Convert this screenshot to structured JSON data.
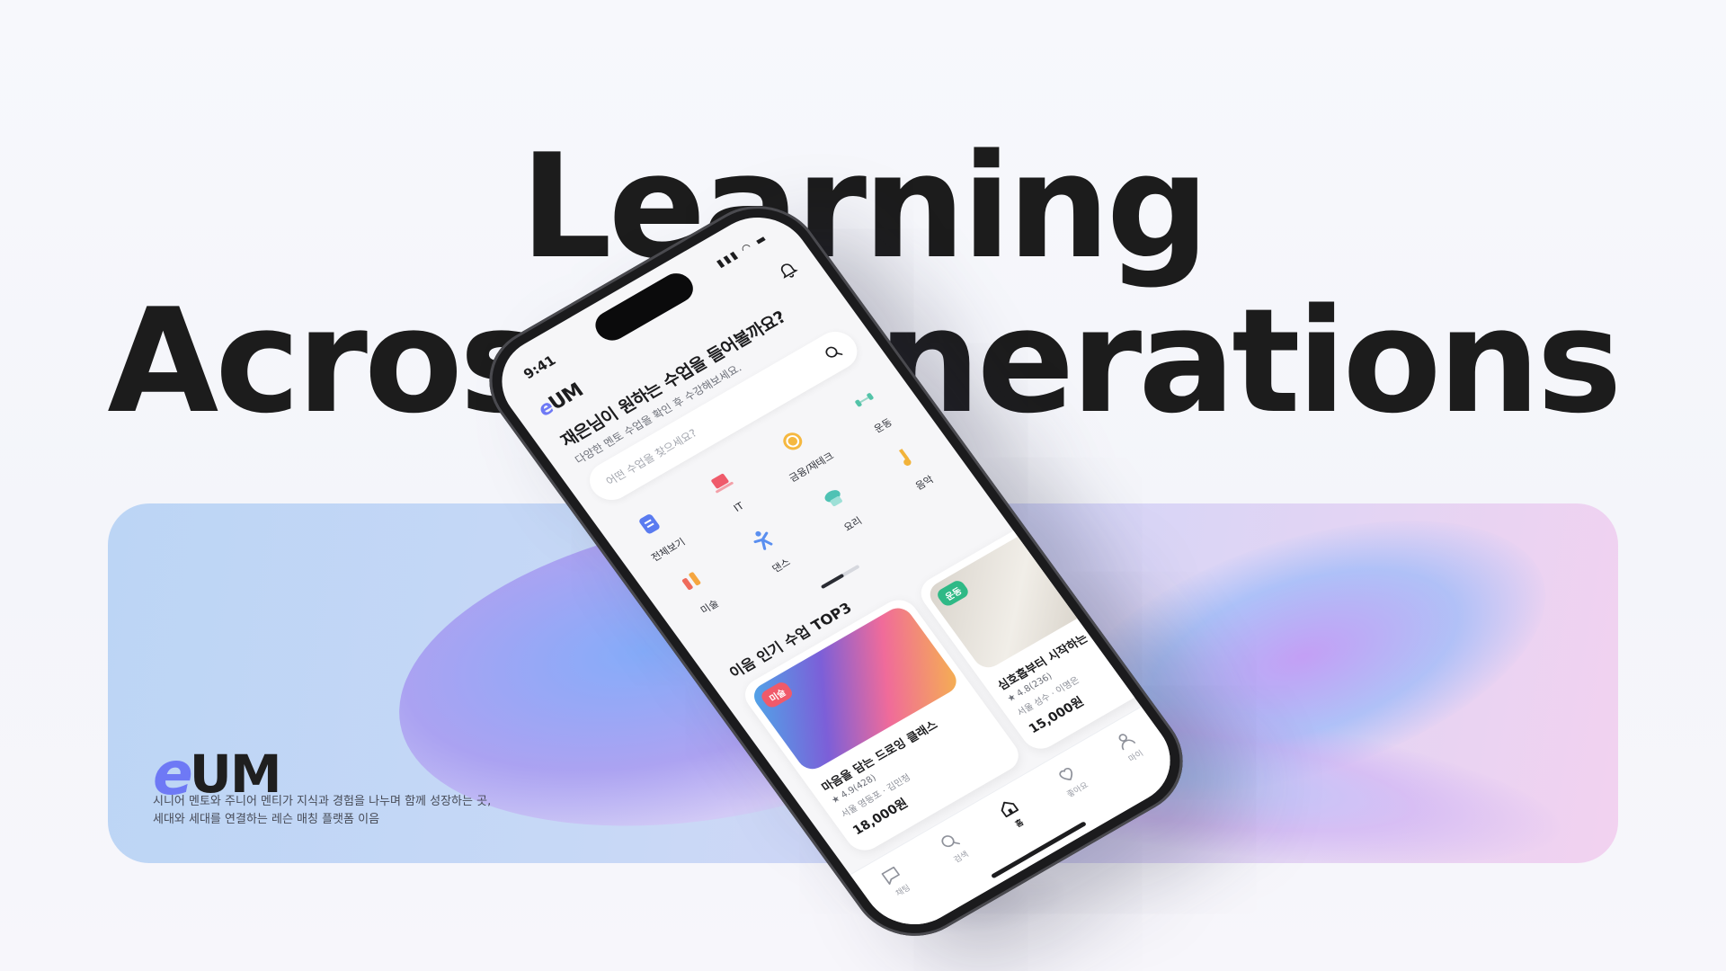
{
  "headline": {
    "line1": "Learning",
    "line2": "Across Generations"
  },
  "banner": {
    "logo_mark": "e",
    "logo_text": "UM",
    "desc_line1": "시니어 멘토와 주니어 멘티가 지식과 경험을 나누며 함께 성장하는 곳,",
    "desc_line2": "세대와 세대를 연결하는 레슨 매칭 플랫폼 이음"
  },
  "phone": {
    "status": {
      "time": "9:41",
      "icons": "▮▮▮ ◠ ▬"
    },
    "app": {
      "logo_mark": "e",
      "logo_text": "UM"
    },
    "greeting": {
      "title": "재은님이 원하는 수업을 들어볼까요?",
      "subtitle": "다양한 멘토 수업을 확인 후 수강해보세요."
    },
    "search": {
      "placeholder": "어떤 수업을 찾으세요?"
    },
    "categories": [
      {
        "label": "전체보기",
        "icon": "grid-icon",
        "color": "#5a7bf0"
      },
      {
        "label": "IT",
        "icon": "laptop-icon",
        "color": "#ef5b6b"
      },
      {
        "label": "금융/재테크",
        "icon": "coin-icon",
        "color": "#f5b840"
      },
      {
        "label": "운동",
        "icon": "dumbbell-icon",
        "color": "#53c3a8"
      },
      {
        "label": "미술",
        "icon": "palette-icon",
        "color": "#ef6b5b"
      },
      {
        "label": "댄스",
        "icon": "dance-icon",
        "color": "#5a8ff0"
      },
      {
        "label": "요리",
        "icon": "chef-hat-icon",
        "color": "#4fc2b4"
      },
      {
        "label": "음악",
        "icon": "music-icon",
        "color": "#f2b33a"
      }
    ],
    "section_title": "이음 인기 수업 TOP3",
    "classes": [
      {
        "tag": "미술",
        "title": "마음을 담는 드로잉 클래스",
        "rating": "★ 4.9(428)",
        "location": "서울 영등포 · 김민정",
        "price": "18,000원"
      },
      {
        "tag": "운동",
        "title": "심호흡부터 시작하는",
        "rating": "★ 4.8(236)",
        "location": "서울 성수 · 이명은",
        "price": "15,000원"
      }
    ],
    "tabs": [
      {
        "label": "채팅",
        "icon": "chat-icon"
      },
      {
        "label": "검색",
        "icon": "search-icon"
      },
      {
        "label": "홈",
        "icon": "home-icon",
        "active": true
      },
      {
        "label": "좋아요",
        "icon": "heart-icon"
      },
      {
        "label": "마이",
        "icon": "user-icon"
      }
    ]
  }
}
